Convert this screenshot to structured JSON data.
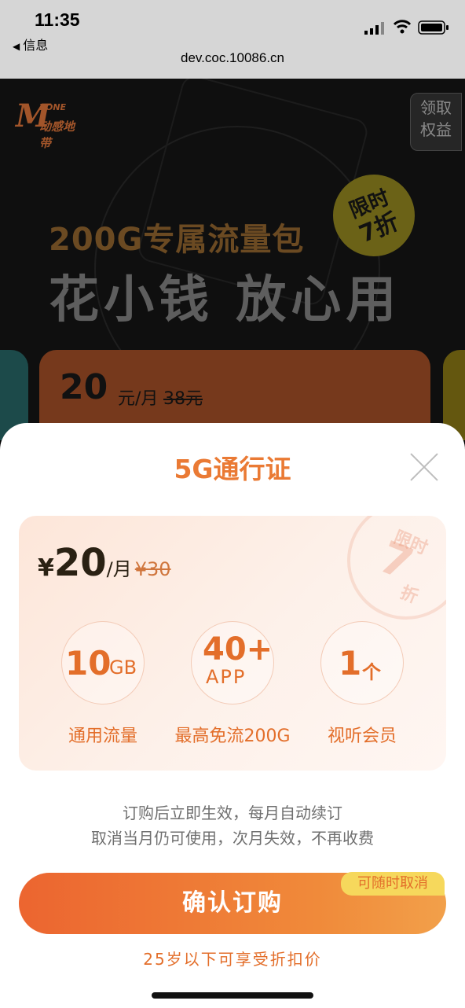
{
  "status_bar": {
    "time": "11:35",
    "back_app": "信息"
  },
  "browser": {
    "url": "dev.coc.10086.cn"
  },
  "promo": {
    "logo": {
      "mark": "M",
      "zone": "ZONE",
      "name": "动感地带"
    },
    "claim_button": [
      "领取",
      "权益"
    ],
    "discount_badge": [
      "限时",
      "7折"
    ],
    "package_title": "200G专属流量包",
    "slogan": "花小钱 放心用",
    "card": {
      "price": "20",
      "unit": "元/月",
      "original": "38元"
    }
  },
  "sheet": {
    "title": "5G通行证",
    "price": {
      "currency": "¥",
      "amount": "20",
      "per": "/月",
      "original": "¥30"
    },
    "stamp": [
      "限时",
      "7",
      "折"
    ],
    "features": [
      {
        "value": "10",
        "unit": "GB",
        "label": "通用流量"
      },
      {
        "value": "40+",
        "unit": "APP",
        "label": "最高免流200G"
      },
      {
        "value": "1",
        "unit": "个",
        "label": "视听会员"
      }
    ],
    "notes": [
      "订购后立即生效，每月自动续订",
      "取消当月仍可使用，次月失效，不再收费"
    ],
    "confirm_label": "确认订购",
    "cancel_badge": "可随时取消",
    "youth_offer": "25岁以下可享受折扣价"
  },
  "colors": {
    "accent": "#e36e2a",
    "button_start": "#ec6530",
    "button_end": "#f2a04a",
    "badge": "#f6d85c"
  }
}
